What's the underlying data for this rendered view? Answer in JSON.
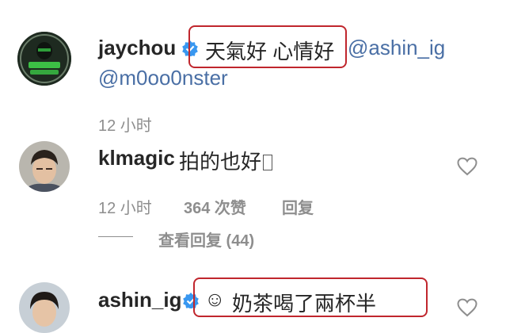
{
  "comments": [
    {
      "username": "jaychou",
      "verified": true,
      "text": "天氣好 心情好",
      "mentions": [
        "@ashin_ig",
        "@m0oo0nster"
      ],
      "time": "12 小时"
    },
    {
      "username": "klmagic",
      "verified": false,
      "text": "拍的也好",
      "time": "12 小时",
      "likes": "364 次赞",
      "reply": "回复",
      "view_replies": "查看回复 (44)"
    },
    {
      "username": "ashin_ig",
      "verified": true,
      "emoji": "☺",
      "text": "奶茶喝了兩杯半"
    }
  ],
  "colors": {
    "highlight_box": "#c0262d",
    "verified_badge": "#3897f0",
    "mention": "#4a6fa5",
    "meta": "#8e8e8e"
  },
  "icons": [
    "verified-badge-icon",
    "heart-outline-icon"
  ]
}
